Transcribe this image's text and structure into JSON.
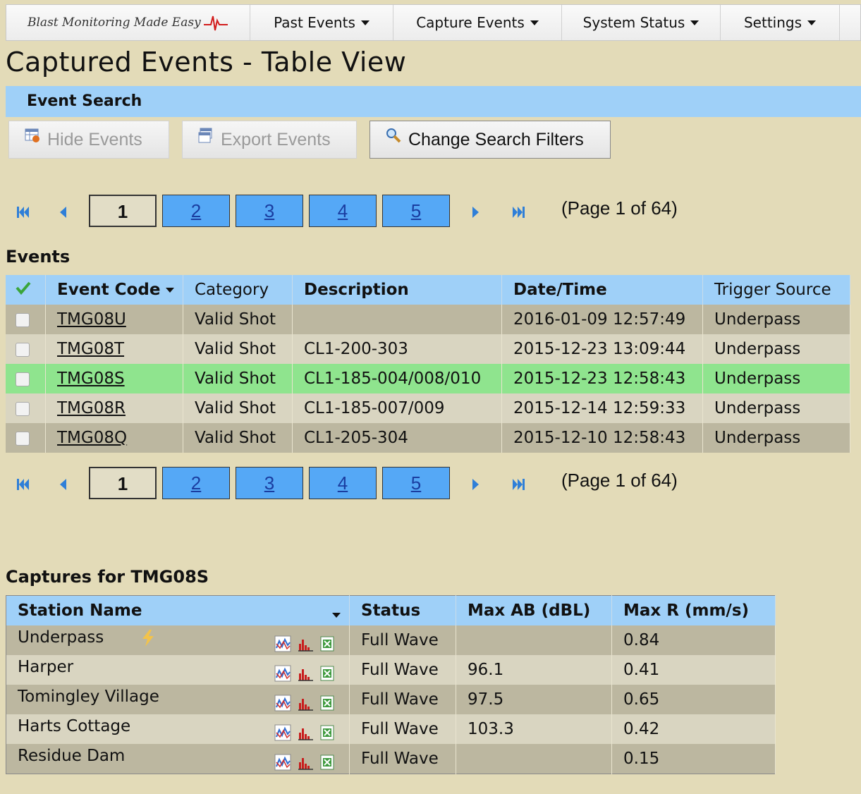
{
  "nav": {
    "logo_text": "Blast Monitoring Made Easy",
    "menus": [
      {
        "label": "Past Events"
      },
      {
        "label": "Capture Events"
      },
      {
        "label": "System Status"
      },
      {
        "label": "Settings"
      }
    ]
  },
  "page_title": "Captured Events - Table View",
  "search_bar": {
    "label": "Event Search"
  },
  "toolbar": {
    "hide_events": "Hide Events",
    "export_events": "Export Events",
    "change_filters": "Change Search Filters"
  },
  "pager": {
    "current": "1",
    "pages": [
      "2",
      "3",
      "4",
      "5"
    ],
    "info": "(Page 1 of 64)"
  },
  "events_heading": "Events",
  "events_table": {
    "columns": [
      "Event Code",
      "Category",
      "Description",
      "Date/Time",
      "Trigger Source"
    ],
    "rows": [
      {
        "code": "TMG08U",
        "category": "Valid Shot",
        "description": "",
        "datetime": "2016-01-09 12:57:49",
        "trigger": "Underpass"
      },
      {
        "code": "TMG08T",
        "category": "Valid Shot",
        "description": "CL1-200-303",
        "datetime": "2015-12-23 13:09:44",
        "trigger": "Underpass"
      },
      {
        "code": "TMG08S",
        "category": "Valid Shot",
        "description": "CL1-185-004/008/010",
        "datetime": "2015-12-23 12:58:43",
        "trigger": "Underpass"
      },
      {
        "code": "TMG08R",
        "category": "Valid Shot",
        "description": "CL1-185-007/009",
        "datetime": "2015-12-14 12:59:33",
        "trigger": "Underpass"
      },
      {
        "code": "TMG08Q",
        "category": "Valid Shot",
        "description": "CL1-205-304",
        "datetime": "2015-12-10 12:58:43",
        "trigger": "Underpass"
      }
    ]
  },
  "captures_heading": "Captures for TMG08S",
  "captures_table": {
    "columns": [
      "Station Name",
      "Status",
      "Max AB (dBL)",
      "Max R (mm/s)"
    ],
    "rows": [
      {
        "station": "Underpass",
        "status": "Full Wave",
        "max_ab": "",
        "max_r": "0.84"
      },
      {
        "station": "Harper",
        "status": "Full Wave",
        "max_ab": "96.1",
        "max_r": "0.41"
      },
      {
        "station": "Tomingley Village",
        "status": "Full Wave",
        "max_ab": "97.5",
        "max_r": "0.65"
      },
      {
        "station": "Harts Cottage",
        "status": "Full Wave",
        "max_ab": "103.3",
        "max_r": "0.42"
      },
      {
        "station": "Residue Dam",
        "status": "Full Wave",
        "max_ab": "",
        "max_r": "0.15"
      }
    ]
  },
  "colors": {
    "page_bg": "#e3dbb8",
    "header_blue": "#9fd0f8",
    "page_button_blue": "#55a8f6",
    "selected_row": "#8fe48e",
    "row_dark": "#bcb7a0",
    "row_light": "#d9d5c1"
  },
  "icons": {
    "trigger": "lightning-icon",
    "waveform": "waveform-chart-icon",
    "histogram": "histogram-chart-icon",
    "export": "excel-export-icon"
  }
}
